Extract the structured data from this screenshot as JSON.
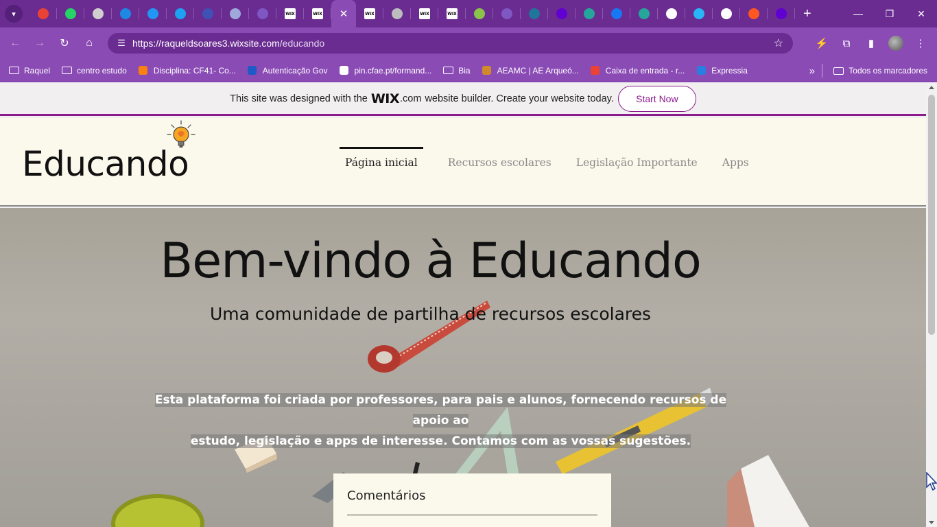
{
  "browser": {
    "tabs": [
      {
        "icon": "gmail-icon",
        "color": "#ea4335"
      },
      {
        "icon": "whatsapp-icon",
        "color": "#25d366"
      },
      {
        "icon": "circle-app-icon",
        "color": "#cfcfcf"
      },
      {
        "icon": "grid-app-icon",
        "color": "#1e88e5"
      },
      {
        "icon": "h-app-icon",
        "color": "#2196f3"
      },
      {
        "icon": "c-app-icon",
        "color": "#1da1f2"
      },
      {
        "icon": "box-app-icon",
        "color": "#3f51b5"
      },
      {
        "icon": "search-app-icon",
        "color": "#9fa8da"
      },
      {
        "icon": "check-app-icon",
        "color": "#7e57c2"
      },
      {
        "icon": "wix-icon",
        "label": "WIX"
      },
      {
        "icon": "wix-icon",
        "label": "WIX"
      },
      {
        "icon": "close-icon",
        "active": true
      },
      {
        "icon": "wix-icon",
        "label": "WIX"
      },
      {
        "icon": "ring-app-icon",
        "color": "#bdbdbd"
      },
      {
        "icon": "wix-icon",
        "label": "WIX"
      },
      {
        "icon": "wix-icon",
        "label": "WIX"
      },
      {
        "icon": "chat-app-icon",
        "color": "#8bc34a"
      },
      {
        "icon": "check-app-icon",
        "color": "#7e57c2"
      },
      {
        "icon": "wordpress-icon",
        "color": "#21759b"
      },
      {
        "icon": "yahoo-icon",
        "color": "#6001d2"
      },
      {
        "icon": "robot-app-icon",
        "color": "#26a69a"
      },
      {
        "icon": "facebook-icon",
        "color": "#1877f2"
      },
      {
        "icon": "robot-app-icon",
        "color": "#26a69a"
      },
      {
        "icon": "doc-app-icon",
        "color": "#ffffff"
      },
      {
        "icon": "edge-app-icon",
        "color": "#29b6f6"
      },
      {
        "icon": "tree-app-icon",
        "color": "#ffffff"
      },
      {
        "icon": "blogger-icon",
        "color": "#ff5722"
      },
      {
        "icon": "yahoo-icon",
        "color": "#6001d2"
      }
    ],
    "url_host": "https://raqueldsoares3.wixsite.com",
    "url_path": "/educando",
    "bookmarks": [
      {
        "label": "Raquel",
        "icon": "folder-icon"
      },
      {
        "label": "centro estudo",
        "icon": "folder-icon"
      },
      {
        "label": "Disciplina: CF41- Co...",
        "icon": "moodle-icon"
      },
      {
        "label": "Autenticação Gov",
        "icon": "gov-icon"
      },
      {
        "label": "pin.cfae.pt/formand...",
        "icon": "pin-icon"
      },
      {
        "label": "Bia",
        "icon": "folder-icon"
      },
      {
        "label": "AEAMC | AE Arqueó...",
        "icon": "school-icon"
      },
      {
        "label": "Caixa de entrada - r...",
        "icon": "gmail-icon"
      },
      {
        "label": "Expressia",
        "icon": "expressia-icon"
      }
    ],
    "all_bookmarks": "Todos os marcadores"
  },
  "wix_banner": {
    "text_before": "This site was designed with the",
    "logo": "WIX",
    "com": ".com",
    "text_after": "website builder. Create your website today.",
    "cta": "Start Now"
  },
  "site": {
    "logo": "Educando",
    "menu": [
      "Página inicial",
      "Recursos escolares",
      "Legislação Importante",
      "Apps"
    ],
    "hero_title": "Bem-vindo à Educando",
    "hero_subtitle": "Uma comunidade de partilha de recursos escolares",
    "hero_body_line1": "Esta plataforma foi criada por professores, para pais e alunos,  fornecendo recursos de apoio ao",
    "hero_body_line2": "estudo, legislação e apps de interesse.  Contamos com as vossas sugestões.",
    "comments_title": "Comentários"
  },
  "colors": {
    "chrome_dark": "#6a2c91",
    "chrome": "#8b4bb5",
    "wix_accent": "#8b1a8c",
    "header_bg": "#fbf9ec"
  }
}
